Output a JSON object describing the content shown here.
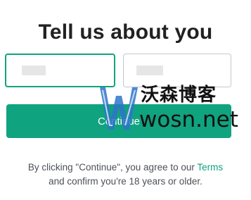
{
  "header": {
    "title": "Tell us about you"
  },
  "form": {
    "first_name": {
      "value": "",
      "placeholder": "",
      "state": "focused"
    },
    "last_name": {
      "value": "",
      "placeholder": "",
      "state": "default"
    },
    "continue_label": "Continue"
  },
  "footer": {
    "disclaimer_prefix": "By clicking \"Continue\", you agree to our ",
    "terms_label": "Terms",
    "disclaimer_suffix": "and confirm you're 18 years or older."
  },
  "watermark": {
    "cn_text": "沃森博客",
    "en_text": "wosn.net"
  },
  "colors": {
    "accent": "#10a37f",
    "title_text": "#202123",
    "body_text": "#4d5057",
    "input_border": "#c2c8d0",
    "watermark_blue": "#2f74c9"
  }
}
